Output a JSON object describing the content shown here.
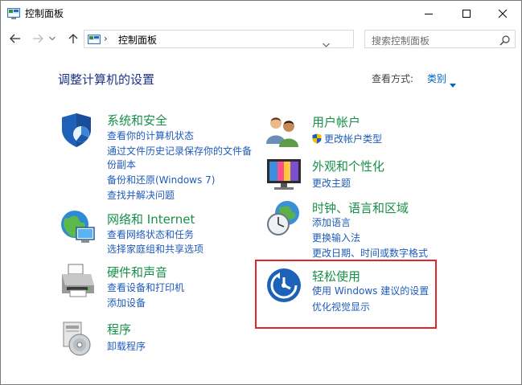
{
  "window": {
    "title": "控制面板",
    "minimize_glyph": "minimize-icon",
    "maximize_glyph": "maximize-icon",
    "close_glyph": "close-icon"
  },
  "nav": {
    "address_separator": "›",
    "address_text": "控制面板",
    "search_placeholder": "搜索控制面板"
  },
  "main": {
    "heading": "调整计算机的设置",
    "view_by_label": "查看方式:",
    "view_by_value": "类别",
    "categories": [
      {
        "title": "系统和安全",
        "links": [
          "查看你的计算机状态",
          "通过文件历史记录保存你的文件备",
          "份副本",
          "备份和还原(Windows 7)",
          "查找并解决问题"
        ]
      },
      {
        "title": "网络和 Internet",
        "links": [
          "查看网络状态和任务",
          "选择家庭组和共享选项"
        ]
      },
      {
        "title": "硬件和声音",
        "links": [
          "查看设备和打印机",
          "添加设备"
        ]
      },
      {
        "title": "程序",
        "links": [
          "卸载程序"
        ]
      },
      {
        "title": "用户帐户",
        "links": [
          "更改帐户类型"
        ]
      },
      {
        "title": "外观和个性化",
        "links": [
          "更改主题"
        ]
      },
      {
        "title": "时钟、语言和区域",
        "links": [
          "添加语言",
          "更换输入法",
          "更改日期、时间或数字格式"
        ]
      },
      {
        "title": "轻松使用",
        "links": [
          "使用 Windows 建议的设置",
          "优化视觉显示"
        ]
      }
    ]
  },
  "colors": {
    "category_title": "#17904a",
    "link": "#1f5bbb",
    "heading": "#1e3287",
    "highlight_border": "#e0262c"
  }
}
